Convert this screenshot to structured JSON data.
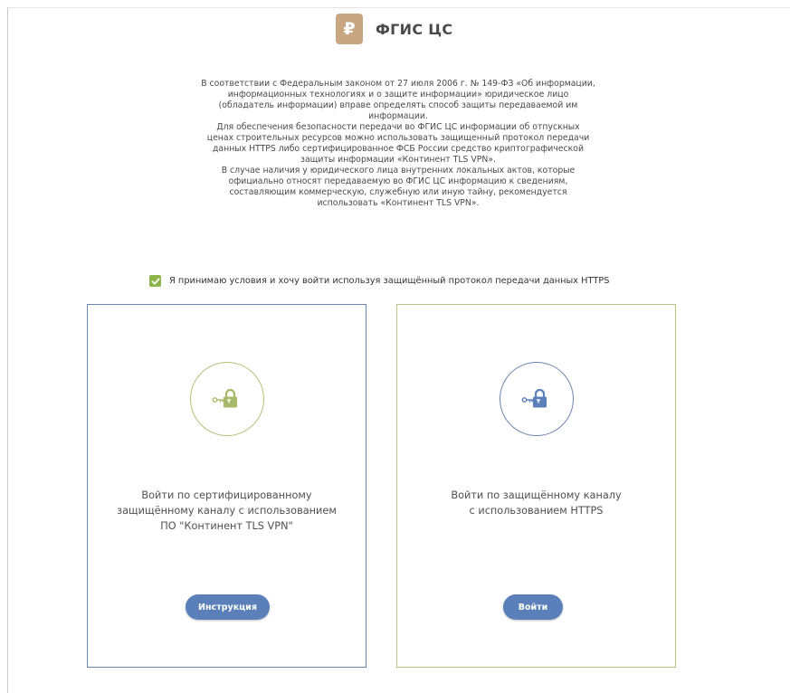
{
  "header": {
    "logo_glyph": "₽",
    "title": "ФГИС ЦС"
  },
  "info": {
    "lines": [
      "В соответствии с Федеральным законом от 27 июля 2006 г. № 149-ФЗ «Об информации,",
      "информационных технологиях и о защите информации» юридическое лицо",
      "(обладатель информации) вправе определять способ защиты передаваемой им",
      "информации.",
      "Для обеспечения безопасности передачи во ФГИС ЦС информации об отпускных",
      "ценах строительных ресурсов можно использовать защищенный протокол передачи",
      "данных HTTPS либо сертифицированное ФСБ России средство криптографической",
      "защиты информации «Континент TLS VPN».",
      "В случае наличия у юридического лица внутренних локальных актов, которые",
      "официально относят передаваемую во ФГИС ЦС информацию к сведениям,",
      "составляющим коммерческую, служебную или иную тайну, рекомендуется",
      "использовать «Континент TLS VPN»."
    ]
  },
  "accept": {
    "checked": true,
    "label": "Я принимаю условия и хочу войти используя защищённый протокол передачи данных HTTPS"
  },
  "cards": {
    "vpn": {
      "icon": "lock-key-icon",
      "text_lines": [
        "Войти по сертифицированному",
        "защищённому каналу с использованием",
        "ПО \"Континент TLS VPN\""
      ],
      "button_label": "Инструкция"
    },
    "https": {
      "icon": "lock-key-icon",
      "text_lines": [
        "Войти по защищённому каналу",
        "с использованием HTTPS"
      ],
      "button_label": "Войти"
    }
  },
  "colors": {
    "logo": "#c8a682",
    "accent_blue": "#5b7fb9",
    "accent_green": "#8db54a",
    "card_vpn_border": "#6b86ad",
    "card_https_border": "#b9c48a"
  }
}
